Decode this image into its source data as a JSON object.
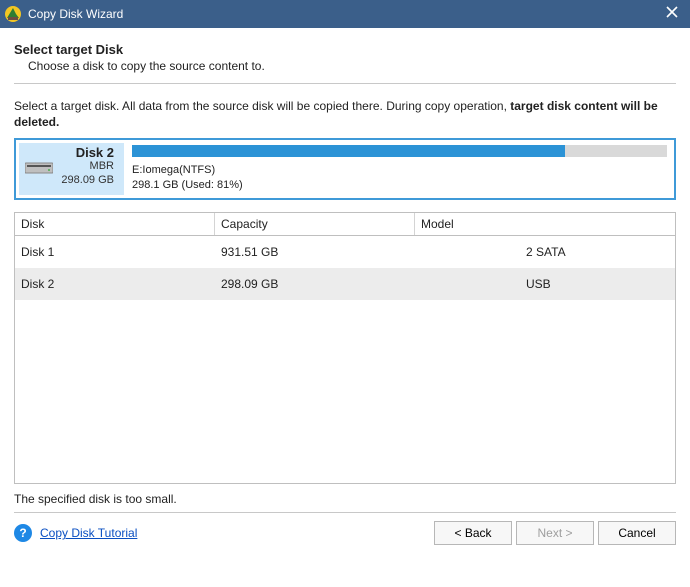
{
  "titlebar": {
    "title": "Copy Disk Wizard"
  },
  "header": {
    "heading": "Select target Disk",
    "subheading": "Choose a disk to copy the source content to."
  },
  "instruction": {
    "pre": "Select a target disk. All data from the source disk will be copied there. During copy operation, ",
    "bold": "target disk content will be deleted."
  },
  "selected": {
    "name": "Disk 2",
    "type": "MBR",
    "size": "298.09 GB",
    "partition_label": "E:Iomega(NTFS)",
    "partition_usage": "298.1 GB (Used: 81%)",
    "used_percent": 81
  },
  "table": {
    "headers": {
      "disk": "Disk",
      "capacity": "Capacity",
      "model": "Model"
    },
    "rows": [
      {
        "disk": "Disk 1",
        "capacity": "931.51 GB",
        "model_hidden": "",
        "bus": "2 SATA",
        "selected": false
      },
      {
        "disk": "Disk 2",
        "capacity": "298.09 GB",
        "model_hidden": "",
        "bus": "USB",
        "selected": true
      }
    ]
  },
  "status": "The specified disk is too small.",
  "footer": {
    "tutorial_label": "Copy Disk Tutorial",
    "back": "< Back",
    "next": "Next >",
    "cancel": "Cancel"
  }
}
